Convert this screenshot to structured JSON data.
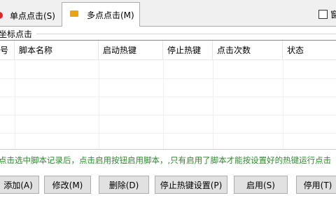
{
  "tabs": {
    "single_label": "单点点击(S)",
    "multi_label": "多点点击(M)",
    "checkbox_label": "窗"
  },
  "group": {
    "title": "坐标点击"
  },
  "table": {
    "columns": [
      "号",
      "脚本名称",
      "启动热键",
      "停止热键",
      "点击次数",
      "状态"
    ],
    "rows": []
  },
  "hint": "点击选中脚本记录后，点击启用按钮启用脚本，,只有启用了脚本才能按设置好的热键运行点击",
  "buttons": {
    "add": "添加(A)",
    "edit": "修改(M)",
    "delete": "删除(D)",
    "stop_hotkey": "停止热键设置(P)",
    "enable": "启用(S)",
    "disable": "停用(T)"
  }
}
